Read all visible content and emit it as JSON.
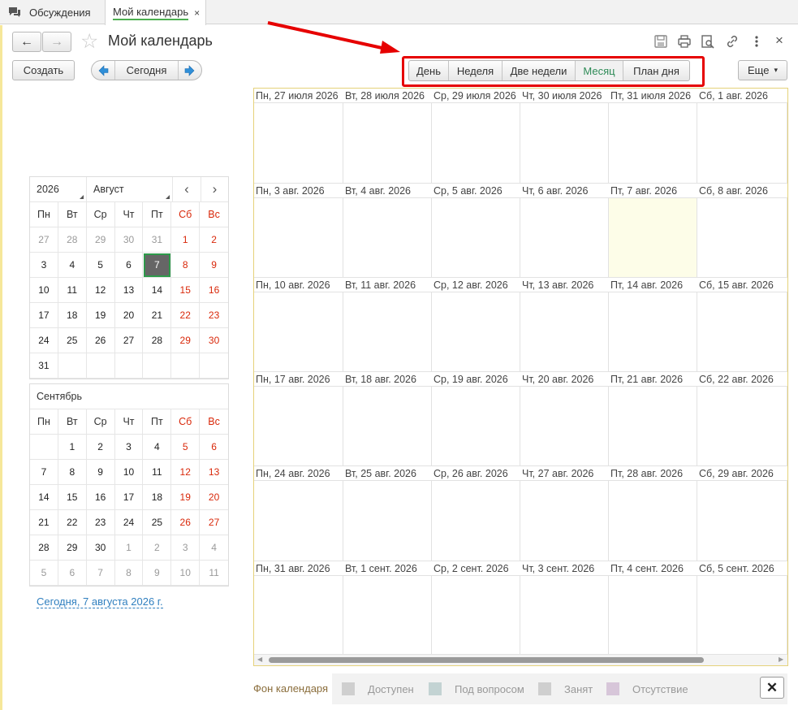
{
  "tabs": [
    {
      "label": "Обсуждения",
      "icon": "chat-icon"
    },
    {
      "label": "Мой календарь",
      "close": "×"
    }
  ],
  "header": {
    "title": "Мой календарь",
    "back": "←",
    "forward": "→",
    "star": "☆",
    "close": "×"
  },
  "toolbar": {
    "create": "Создать",
    "today": "Сегодня",
    "more": "Еще",
    "more_caret": "▾",
    "views": [
      "День",
      "Неделя",
      "Две недели",
      "Месяц",
      "План дня"
    ],
    "active_view": "Месяц"
  },
  "month_grid": {
    "rows": [
      [
        "Пн, 27 июля 2026",
        "Вт, 28 июля 2026",
        "Ср, 29 июля 2026",
        "Чт, 30 июля 2026",
        "Пт, 31 июля 2026",
        "Сб, 1 авг. 2026"
      ],
      [
        "Пн, 3 авг. 2026",
        "Вт, 4 авг. 2026",
        "Ср, 5 авг. 2026",
        "Чт, 6 авг. 2026",
        "Пт, 7 авг. 2026",
        "Сб, 8 авг. 2026"
      ],
      [
        "Пн, 10 авг. 2026",
        "Вт, 11 авг. 2026",
        "Ср, 12 авг. 2026",
        "Чт, 13 авг. 2026",
        "Пт, 14 авг. 2026",
        "Сб, 15 авг. 2026"
      ],
      [
        "Пн, 17 авг. 2026",
        "Вт, 18 авг. 2026",
        "Ср, 19 авг. 2026",
        "Чт, 20 авг. 2026",
        "Пт, 21 авг. 2026",
        "Сб, 22 авг. 2026"
      ],
      [
        "Пн, 24 авг. 2026",
        "Вт, 25 авг. 2026",
        "Ср, 26 авг. 2026",
        "Чт, 27 авг. 2026",
        "Пт, 28 авг. 2026",
        "Сб, 29 авг. 2026"
      ],
      [
        "Пн, 31 авг. 2026",
        "Вт, 1 сент. 2026",
        "Ср, 2 сент. 2026",
        "Чт, 3 сент. 2026",
        "Пт, 4 сент. 2026",
        "Сб, 5 сент. 2026"
      ]
    ],
    "today_cell": [
      1,
      4
    ],
    "today_color": "#fdfde8"
  },
  "mini_calendar": {
    "year": "2026",
    "month": "Август",
    "prev": "‹",
    "next": "›",
    "weekdays": [
      "Пн",
      "Вт",
      "Ср",
      "Чт",
      "Пт",
      "Сб",
      "Вс"
    ],
    "august": [
      [
        "27",
        "28",
        "29",
        "30",
        "31",
        "1",
        "2"
      ],
      [
        "3",
        "4",
        "5",
        "6",
        "7",
        "8",
        "9"
      ],
      [
        "10",
        "11",
        "12",
        "13",
        "14",
        "15",
        "16"
      ],
      [
        "17",
        "18",
        "19",
        "20",
        "21",
        "22",
        "23"
      ],
      [
        "24",
        "25",
        "26",
        "27",
        "28",
        "29",
        "30"
      ],
      [
        "31",
        "",
        "",
        "",
        "",
        "",
        ""
      ]
    ],
    "august_dim_first_row_count": 5,
    "selected_day": "7",
    "september_title": "Сентябрь",
    "september": [
      [
        "",
        "1",
        "2",
        "3",
        "4",
        "5",
        "6"
      ],
      [
        "7",
        "8",
        "9",
        "10",
        "11",
        "12",
        "13"
      ],
      [
        "14",
        "15",
        "16",
        "17",
        "18",
        "19",
        "20"
      ],
      [
        "21",
        "22",
        "23",
        "24",
        "25",
        "26",
        "27"
      ],
      [
        "28",
        "29",
        "30",
        "1",
        "2",
        "3",
        "4"
      ],
      [
        "5",
        "6",
        "7",
        "8",
        "9",
        "10",
        "11"
      ]
    ],
    "today_link": "Сегодня, 7 августа 2026 г."
  },
  "legend": {
    "label": "Фон календаря",
    "items": [
      {
        "label": "Доступен",
        "color": "#cfcfcf"
      },
      {
        "label": "Под вопросом",
        "color": "#c3d3d3"
      },
      {
        "label": "Занят",
        "color": "#cfcfcf"
      },
      {
        "label": "Отсутствие",
        "color": "#d7c6d9"
      }
    ],
    "close": "✕"
  },
  "colors": {
    "accent": "#2e8b57",
    "weekend": "#d9280a",
    "link": "#2f7fbf",
    "highlight": "#e60000"
  }
}
